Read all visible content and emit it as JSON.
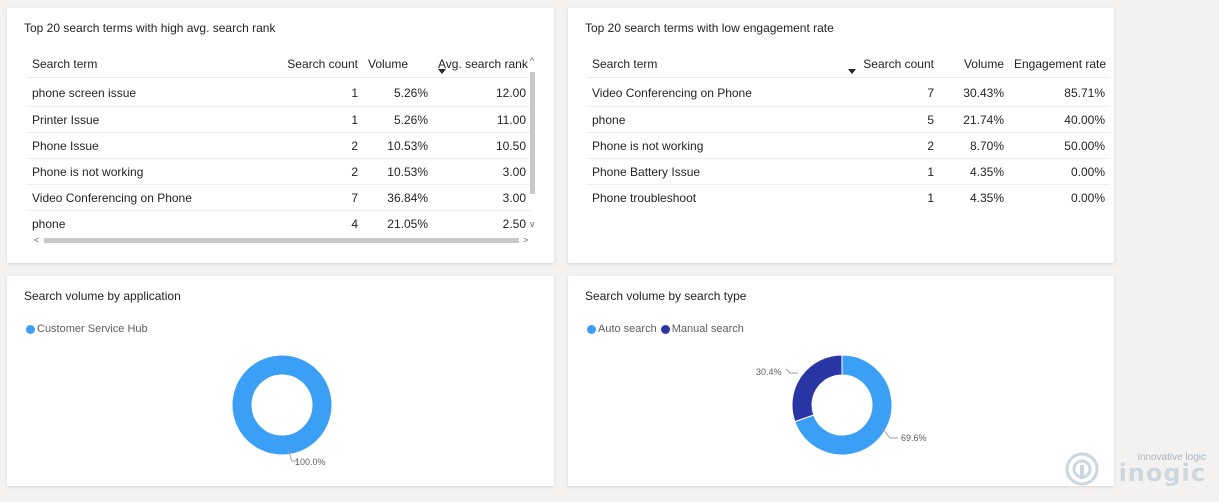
{
  "panels": {
    "high_rank": {
      "title": "Top 20 search terms with high avg. search rank",
      "columns": [
        "Search term",
        "Search count",
        "Volume",
        "Avg. search rank"
      ],
      "rows": [
        [
          "phone screen issue",
          "1",
          "5.26%",
          "12.00"
        ],
        [
          "Printer Issue",
          "1",
          "5.26%",
          "11.00"
        ],
        [
          "Phone Issue",
          "2",
          "10.53%",
          "10.50"
        ],
        [
          "Phone is not working",
          "2",
          "10.53%",
          "3.00"
        ],
        [
          "Video Conferencing on Phone",
          "7",
          "36.84%",
          "3.00"
        ],
        [
          "phone",
          "4",
          "21.05%",
          "2.50"
        ]
      ]
    },
    "low_engagement": {
      "title": "Top 20 search terms with low engagement rate",
      "columns": [
        "Search term",
        "Search count",
        "Volume",
        "Engagement rate"
      ],
      "rows": [
        [
          "Video Conferencing on Phone",
          "7",
          "30.43%",
          "85.71%"
        ],
        [
          "phone",
          "5",
          "21.74%",
          "40.00%"
        ],
        [
          "Phone is not working",
          "2",
          "8.70%",
          "50.00%"
        ],
        [
          "Phone Battery Issue",
          "1",
          "4.35%",
          "0.00%"
        ],
        [
          "Phone troubleshoot",
          "1",
          "4.35%",
          "0.00%"
        ]
      ]
    },
    "by_application": {
      "title": "Search volume by application",
      "legend": [
        {
          "label": "Customer Service Hub",
          "color": "#3a9ff5"
        }
      ],
      "slice_label": "100.0%"
    },
    "by_type": {
      "title": "Search volume by search type",
      "legend": [
        {
          "label": "Auto search",
          "color": "#3a9ff5"
        },
        {
          "label": "Manual search",
          "color": "#2b36a6"
        }
      ],
      "auto_label": "69.6%",
      "manual_label": "30.4%"
    }
  },
  "chart_data": [
    {
      "type": "pie",
      "title": "Search volume by application",
      "categories": [
        "Customer Service Hub"
      ],
      "values": [
        100.0
      ]
    },
    {
      "type": "pie",
      "title": "Search volume by search type",
      "categories": [
        "Auto search",
        "Manual search"
      ],
      "values": [
        69.6,
        30.4
      ]
    }
  ],
  "watermark": {
    "tagline": "innovative logic",
    "brand": "inogic"
  }
}
